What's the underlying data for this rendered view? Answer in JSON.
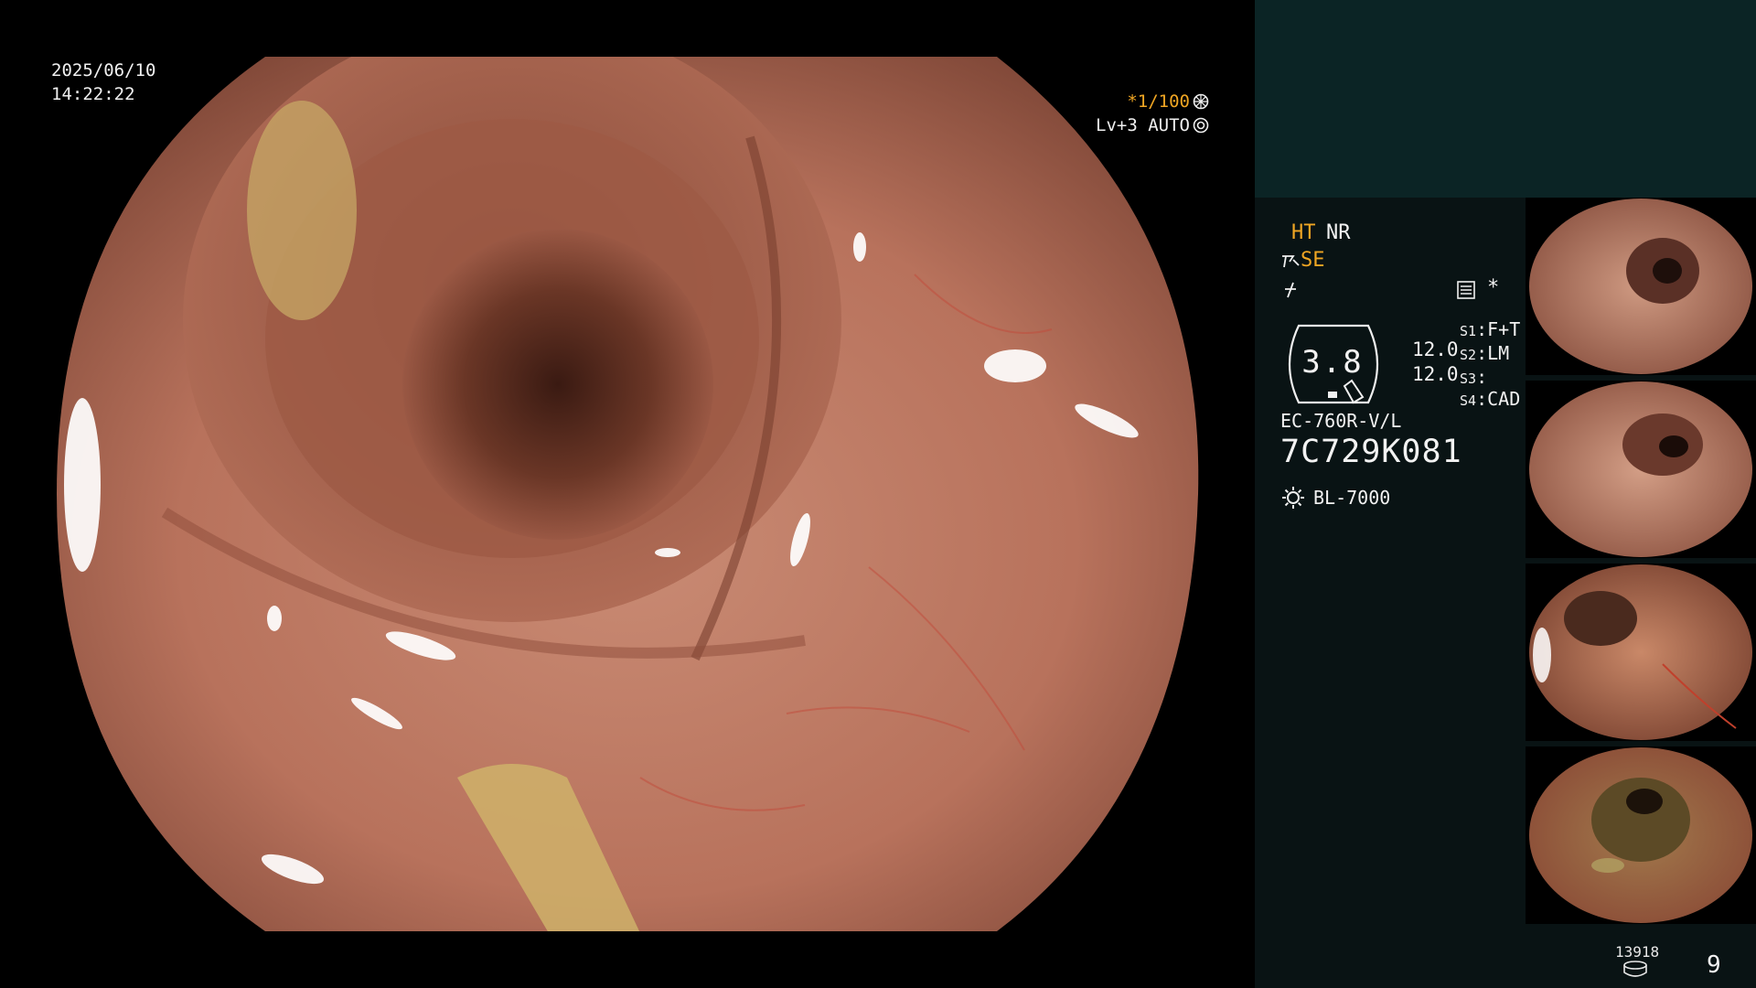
{
  "osd": {
    "date": "2025/06/10",
    "time": "14:22:22",
    "shutter": "*1/100",
    "level": "Lv+3",
    "iris": "AUTO"
  },
  "panel": {
    "mode_ht": "HT",
    "mode_nr": "NR",
    "mode_se": "SE",
    "star": "*",
    "gauge_value": "3.8",
    "gauge_r1": "12.0",
    "gauge_r2": "12.0",
    "switches": [
      {
        "key": "S1",
        "value": "F+T"
      },
      {
        "key": "S2",
        "value": "LM"
      },
      {
        "key": "S3",
        "value": ""
      },
      {
        "key": "S4",
        "value": "CAD"
      }
    ],
    "scope_model": "EC-760R-V/L",
    "scope_serial": "7C729K081",
    "light_source": "BL-7000"
  },
  "footer": {
    "count": "13918",
    "page": "9"
  },
  "icons": [
    "aperture-icon",
    "iris-icon",
    "function-icon",
    "freeze-icon",
    "menu-icon",
    "light-source-icon",
    "disk-icon"
  ],
  "colors": {
    "accent": "#f0a623",
    "panel_bg": "#091314",
    "panel_top": "#0b2425",
    "tissue": "#b9735f"
  }
}
